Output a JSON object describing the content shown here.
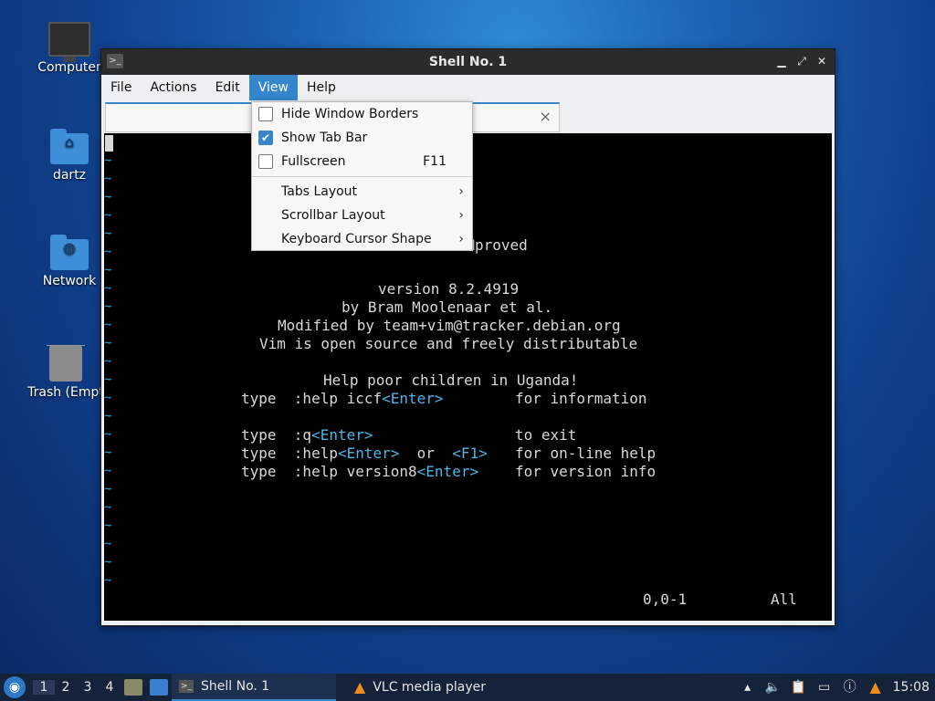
{
  "desktop": {
    "icons": [
      {
        "label": "Computer",
        "icon": "computer-icon"
      },
      {
        "label": "dartz",
        "icon": "home-folder-icon"
      },
      {
        "label": "Network",
        "icon": "network-folder-icon"
      },
      {
        "label": "Trash (Empt",
        "icon": "trash-icon"
      }
    ]
  },
  "window": {
    "title": "Shell No. 1",
    "menubar": [
      "File",
      "Actions",
      "Edit",
      "View",
      "Help"
    ],
    "tab_close": "×"
  },
  "view_menu": {
    "items": [
      {
        "label": "Hide Window Borders",
        "checked": false
      },
      {
        "label": "Show Tab Bar",
        "checked": true
      },
      {
        "label": "Fullscreen",
        "checked": false,
        "shortcut": "F11"
      }
    ],
    "submenus": [
      "Tabs Layout",
      "Scrollbar Layout",
      "Keyboard Cursor Shape"
    ]
  },
  "terminal": {
    "vim_title": "VIM - Vi IMproved",
    "version": "version 8.2.4919",
    "author": "by Bram Moolenaar et al.",
    "modified": "Modified by team+vim@tracker.debian.org",
    "license": "Vim is open source and freely distributable",
    "uganda": "Help poor children in Uganda!",
    "help_iccf": {
      "type": "type",
      "cmd": ":help iccf",
      "key": "<Enter>",
      "desc": "for information"
    },
    "quit": {
      "type": "type",
      "cmd": ":q",
      "key": "<Enter>",
      "desc": "to exit"
    },
    "help": {
      "type": "type",
      "cmd": ":help",
      "key": "<Enter>",
      "or": "or",
      "key2": "<F1>",
      "desc": "for on-line help"
    },
    "help_version": {
      "type": "type",
      "cmd": ":help version8",
      "key": "<Enter>",
      "desc": "for version info"
    },
    "ruler_pos": "0,0-1",
    "ruler_all": "All",
    "tilde": "~"
  },
  "taskbar": {
    "workspaces": [
      "1",
      "2",
      "3",
      "4"
    ],
    "tasks": [
      {
        "label": "Shell No. 1",
        "active": true
      },
      {
        "label": "VLC media player",
        "active": false
      }
    ],
    "clock": "15:08"
  }
}
